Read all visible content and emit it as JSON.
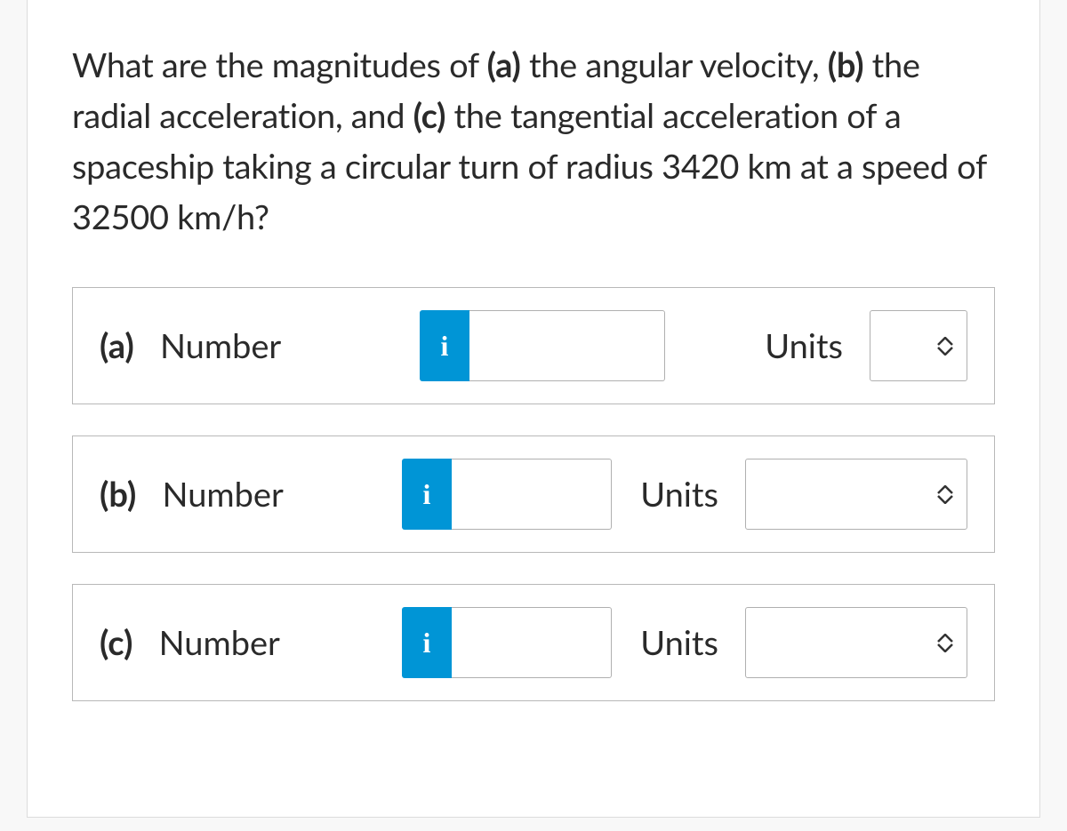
{
  "question": {
    "prefix": "What are the magnitudes of ",
    "part_a_label": "(a)",
    "part_a_text": " the angular velocity, ",
    "part_b_label": "(b)",
    "part_b_text": " the radial acceleration, and ",
    "part_c_label": "(c)",
    "part_c_text": " the tangential acceleration of a spaceship taking a circular turn of radius 3420 km at a speed of 32500 km/h?"
  },
  "rows": {
    "a": {
      "label_bold": "(a)",
      "label_text": "   Number",
      "hint_icon": "i",
      "number_value": "",
      "units_label": "Units",
      "units_value": ""
    },
    "b": {
      "label_bold": "(b)",
      "label_text": "   Number",
      "hint_icon": "i",
      "number_value": "",
      "units_label": "Units",
      "units_value": ""
    },
    "c": {
      "label_bold": "(c)",
      "label_text": "   Number",
      "hint_icon": "i",
      "number_value": "",
      "units_label": "Units",
      "units_value": ""
    }
  }
}
